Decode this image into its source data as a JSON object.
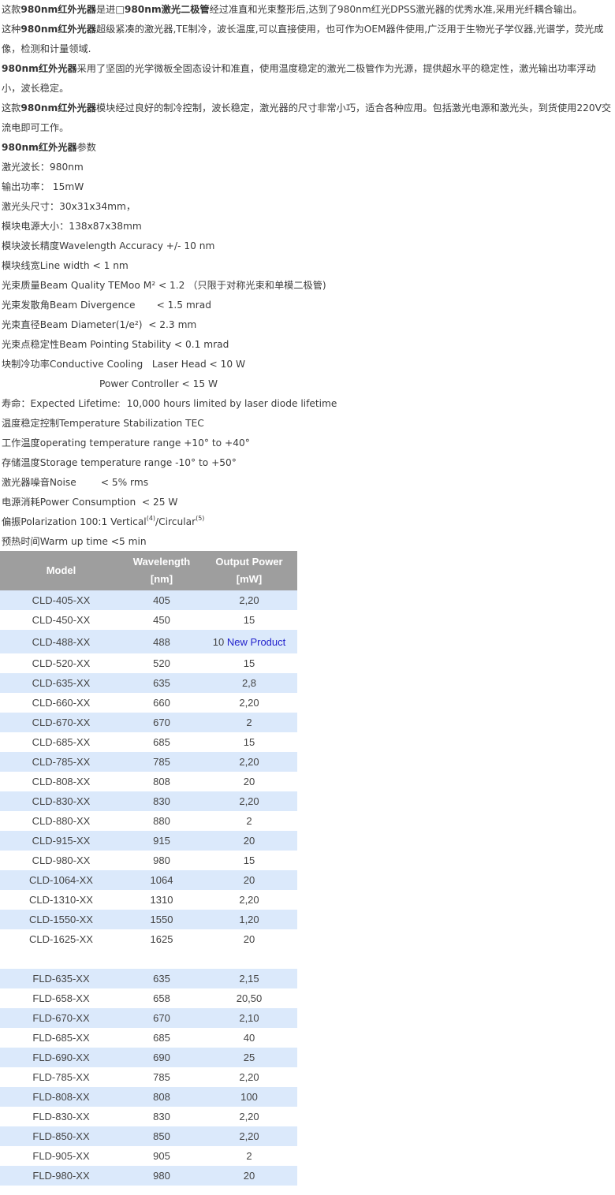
{
  "intro": {
    "p1": {
      "pre": "这款",
      "bold1": "980nm红外光器",
      "mid": "是进□",
      "bold2": "980nm激光二极管",
      "post": "经过准直和光束整形后,达到了980nm红光DPSS激光器的优秀水准,采用光纤耦合输出。"
    },
    "p2": {
      "pre": "这种",
      "bold": "980nm红外光器",
      "post": "超级紧凑的激光器,TE制冷，波长温度,可以直接使用，也可作为OEM器件使用,广泛用于生物光子学仪器,光谱学，荧光成像，检测和计量领域."
    },
    "p3": {
      "bold": "980nm红外光器",
      "post": "采用了坚固的光学微板全固态设计和准直，使用温度稳定的激光二极管作为光源，提供超水平的稳定性，激光输出功率浮动小，波长稳定。"
    },
    "p4": {
      "pre": "这款",
      "bold": "980nm红外光器",
      "post": "模块经过良好的制冷控制，波长稳定，激光器的尺寸非常小巧，适合各种应用。包括激光电源和激光头，到货使用220V交流电即可工作。"
    },
    "params_heading_bold": "980nm红外光器",
    "params_heading_rest": "参数"
  },
  "specs": [
    "激光波长：980nm",
    "输出功率： 15mW",
    "激光头尺寸：30x31x34mm，",
    "模块电源大小：138x87x38mm",
    "模块波长精度Wavelength Accuracy +/- 10 nm",
    "模块线宽Line width < 1 nm",
    "光束质量Beam Quality TEMoo M² < 1.2 （只限于对称光束和单模二极管)",
    "光束发散角Beam Divergence       < 1.5 mrad",
    "光束直径Beam Diameter(1/e²)  < 2.3 mm",
    "光束点稳定性Beam Pointing Stability < 0.1 mrad",
    "块制冷功率Conductive Cooling   Laser Head < 10 W",
    "Power Controller < 15 W",
    "寿命：Expected Lifetime:  10,000 hours limited by laser diode lifetime",
    "温度稳定控制Temperature Stabilization TEC",
    "工作温度operating temperature range +10° to +40°",
    "存储温度Storage temperature range -10° to +50°",
    "激光器噪音Noise        < 5% rms",
    "电源消耗Power Consumption  < 25 W"
  ],
  "polarization": {
    "text": "偏振Polarization 100:1 Vertical",
    "sup1": "(4)",
    "mid": "/Circular",
    "sup2": "(5)"
  },
  "warmup": "预热时间Warm up time <5 min",
  "table": {
    "headers": {
      "model": "Model",
      "wavelength_1": "Wavelength",
      "wavelength_2": "[nm]",
      "power_1": "Output Power",
      "power_2": "[mW]"
    },
    "rows": [
      [
        "CLD-405-XX",
        "405",
        "2,20"
      ],
      [
        "CLD-450-XX",
        "450",
        "15"
      ],
      [
        "CLD-488-XX",
        "488",
        "10"
      ],
      [
        "CLD-520-XX",
        "520",
        "15"
      ],
      [
        "CLD-635-XX",
        "635",
        "2,8"
      ],
      [
        "CLD-660-XX",
        "660",
        "2,20"
      ],
      [
        "CLD-670-XX",
        "670",
        "2"
      ],
      [
        "CLD-685-XX",
        "685",
        "15"
      ],
      [
        "CLD-785-XX",
        "785",
        "2,20"
      ],
      [
        "CLD-808-XX",
        "808",
        "20"
      ],
      [
        "CLD-830-XX",
        "830",
        "2,20"
      ],
      [
        "CLD-880-XX",
        "880",
        "2"
      ],
      [
        "CLD-915-XX",
        "915",
        "20"
      ],
      [
        "CLD-980-XX",
        "980",
        "15"
      ],
      [
        "CLD-1064-XX",
        "1064",
        "20"
      ],
      [
        "CLD-1310-XX",
        "1310",
        "2,20"
      ],
      [
        "CLD-1550-XX",
        "1550",
        "1,20"
      ],
      [
        "CLD-1625-XX",
        "1625",
        "20"
      ],
      [
        "",
        "",
        ""
      ],
      [
        "FLD-635-XX",
        "635",
        "2,15"
      ],
      [
        "FLD-658-XX",
        "658",
        "20,50"
      ],
      [
        "FLD-670-XX",
        "670",
        "2,10"
      ],
      [
        "FLD-685-XX",
        "685",
        "40"
      ],
      [
        "FLD-690-XX",
        "690",
        "25"
      ],
      [
        "FLD-785-XX",
        "785",
        "2,20"
      ],
      [
        "FLD-808-XX",
        "808",
        "100"
      ],
      [
        "FLD-830-XX",
        "830",
        "2,20"
      ],
      [
        "FLD-850-XX",
        "850",
        "2,20"
      ],
      [
        "FLD-905-XX",
        "905",
        "2"
      ],
      [
        "FLD-980-XX",
        "980",
        "20"
      ]
    ],
    "new_product_label": "New Product",
    "new_product_row": 2,
    "highlight_color": "#dbe9fb",
    "header_color": "#9e9e9e",
    "link_color": "#2222cc"
  }
}
